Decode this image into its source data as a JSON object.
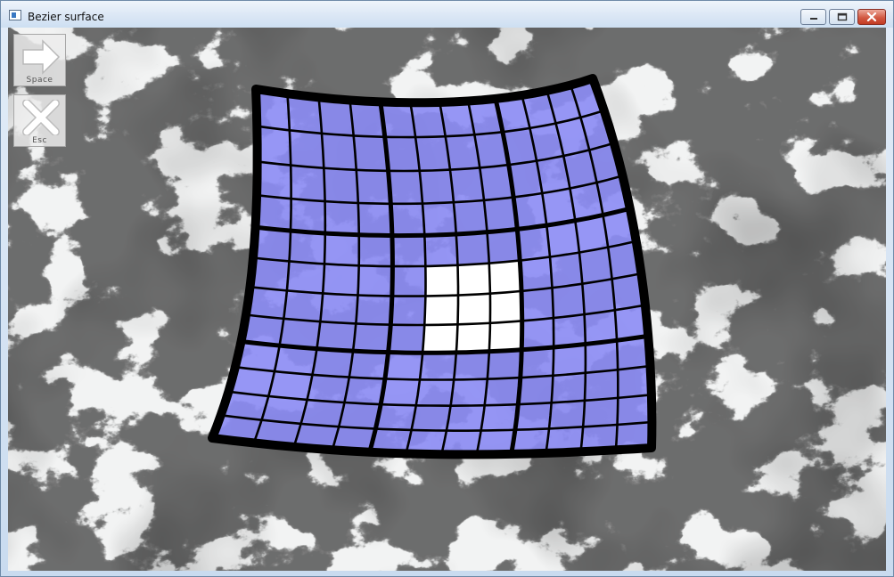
{
  "window": {
    "title": "Bezier surface",
    "icon": "app-window-icon"
  },
  "controls": {
    "minimize_icon": "minimize-icon",
    "maximize_icon": "maximize-icon",
    "close_icon": "close-icon"
  },
  "toolbar": {
    "space_label": "Space",
    "space_icon": "arrow-right-icon",
    "esc_label": "Esc",
    "esc_icon": "x-icon"
  },
  "scene": {
    "background": "marble-texture",
    "surface_color": "#8c8cf5",
    "grid_line_color": "#000000",
    "highlight_color": "#ffffff"
  }
}
